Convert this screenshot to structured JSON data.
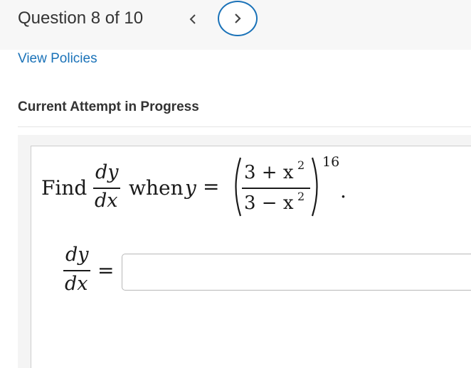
{
  "header": {
    "question_label": "Question 8 of 10",
    "prev_symbol": "<",
    "next_symbol": ">"
  },
  "links": {
    "view_policies": "View Policies"
  },
  "attempt_heading": "Current Attempt in Progress",
  "question": {
    "find_word": "Find",
    "dy": "dy",
    "dx": "dx",
    "when_word": "when",
    "y_var": "y",
    "equals": "=",
    "numerator": "3 + x",
    "denominator": "3 − x",
    "inner_exponent": "2",
    "outer_exponent": "16",
    "period": "."
  },
  "answer": {
    "dy": "dy",
    "dx": "dx",
    "equals": "=",
    "value": "",
    "placeholder": ""
  },
  "colors": {
    "link": "#1a72b8",
    "text": "#333333",
    "header_bg": "#f7f7f7"
  }
}
